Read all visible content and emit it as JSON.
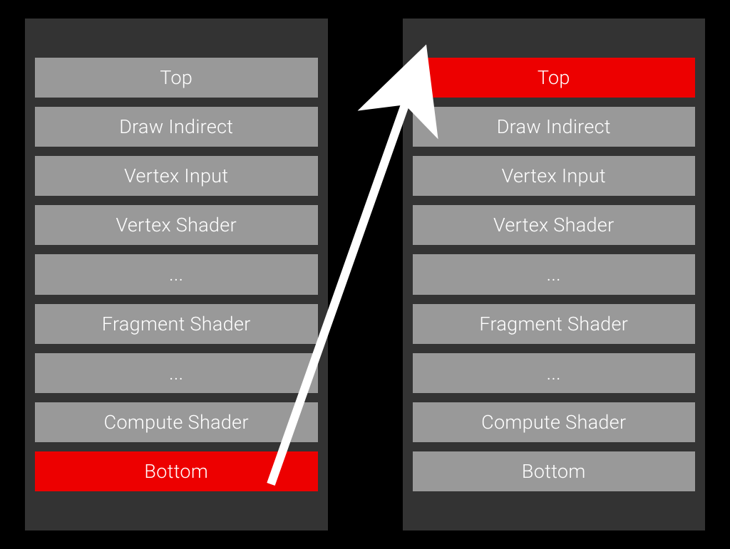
{
  "left_panel": {
    "stages": [
      {
        "label": "Top",
        "highlight": false
      },
      {
        "label": "Draw Indirect",
        "highlight": false
      },
      {
        "label": "Vertex Input",
        "highlight": false
      },
      {
        "label": "Vertex Shader",
        "highlight": false
      },
      {
        "label": "...",
        "highlight": false
      },
      {
        "label": "Fragment Shader",
        "highlight": false
      },
      {
        "label": "...",
        "highlight": false
      },
      {
        "label": "Compute Shader",
        "highlight": false
      },
      {
        "label": "Bottom",
        "highlight": true
      }
    ]
  },
  "right_panel": {
    "stages": [
      {
        "label": "Top",
        "highlight": true
      },
      {
        "label": "Draw Indirect",
        "highlight": false
      },
      {
        "label": "Vertex Input",
        "highlight": false
      },
      {
        "label": "Vertex Shader",
        "highlight": false
      },
      {
        "label": "...",
        "highlight": false
      },
      {
        "label": "Fragment Shader",
        "highlight": false
      },
      {
        "label": "...",
        "highlight": false
      },
      {
        "label": "Compute Shader",
        "highlight": false
      },
      {
        "label": "Bottom",
        "highlight": false
      }
    ]
  },
  "arrow": {
    "from": "left-bottom",
    "to": "right-top"
  }
}
